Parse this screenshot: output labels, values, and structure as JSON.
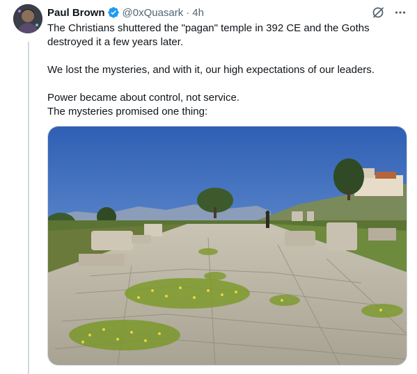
{
  "tweet": {
    "author_name": "Paul Brown",
    "handle": "@0xQuasark",
    "separator": "·",
    "time": "4h",
    "lines": [
      "The Christians shuttered the \"pagan\" temple in 392 CE and the Goths",
      "destroyed it a few years later.",
      "We lost the mysteries, and with it, our high expectations of our leaders.",
      "Power became about control, not service.",
      "The mysteries promised one thing:"
    ]
  },
  "icons": {
    "verified": "verified-badge-icon",
    "grok": "grok-icon",
    "more": "more-icon"
  },
  "colors": {
    "verified_blue": "#1d9bf0",
    "muted_text": "#536471",
    "thread_line": "#cfd9de"
  }
}
